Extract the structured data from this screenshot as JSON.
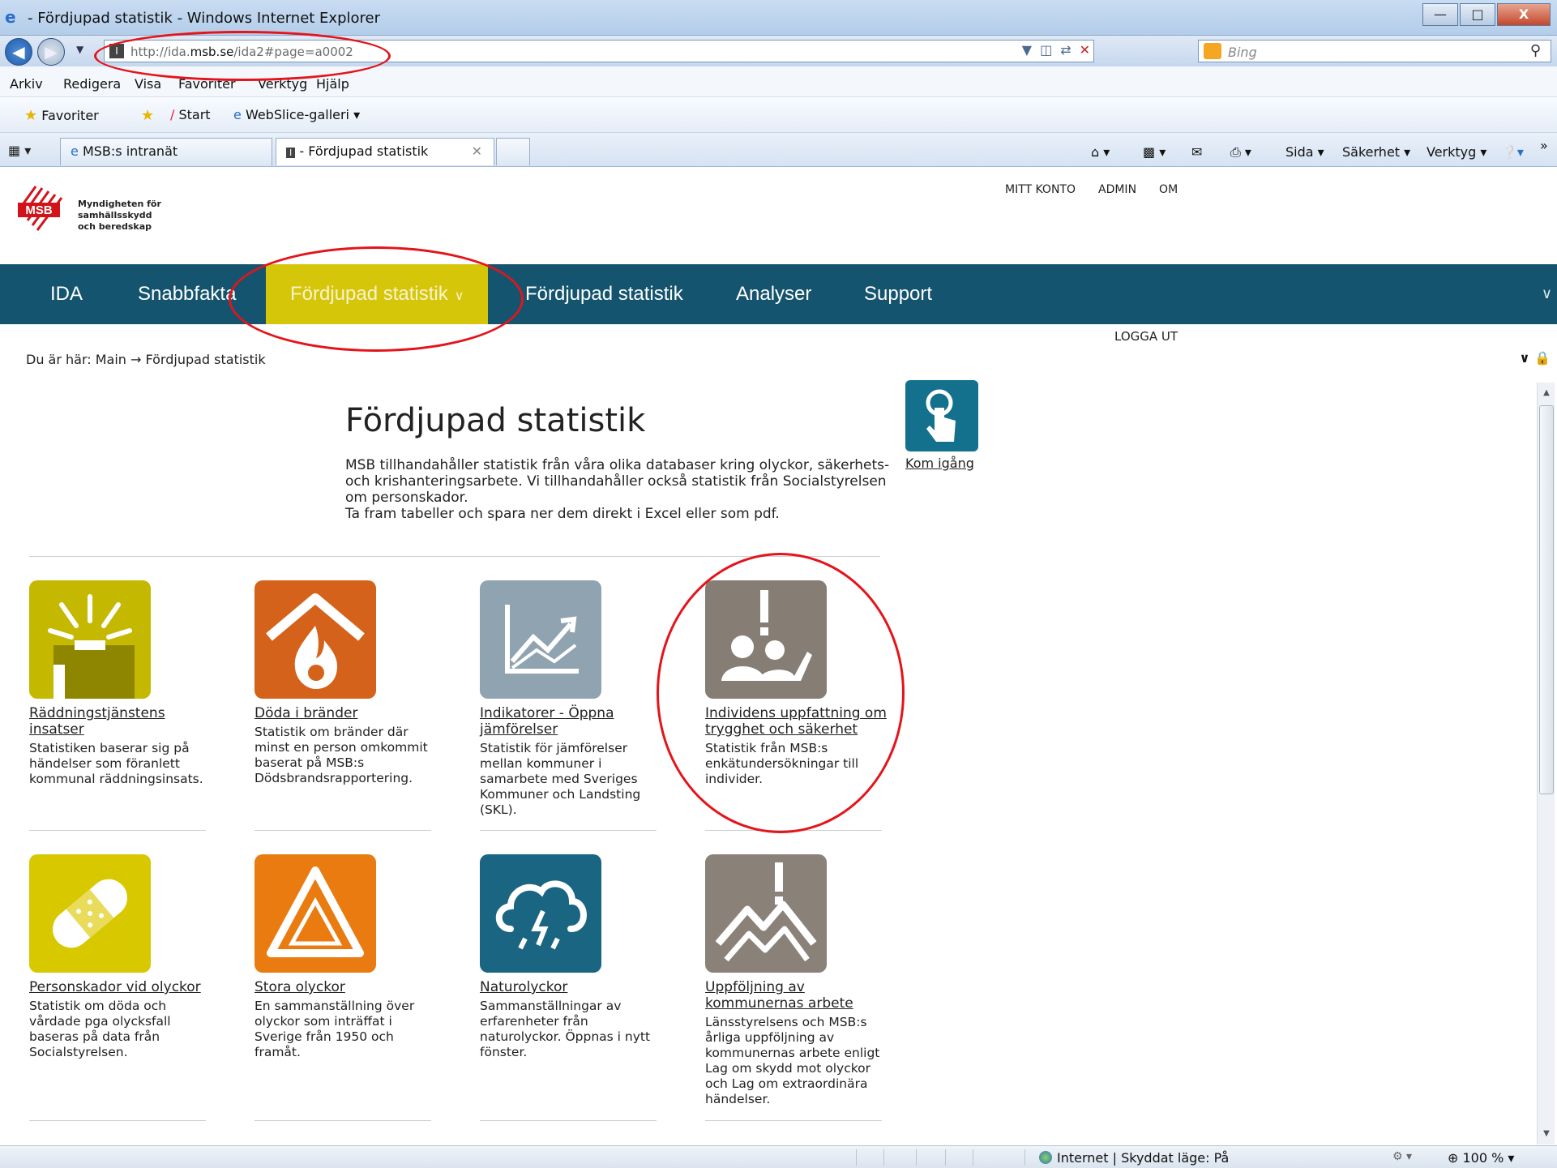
{
  "window": {
    "title": "- Fördjupad statistik - Windows Internet Explorer",
    "min_icon": "minimize-icon",
    "max_icon": "maximize-icon",
    "close_label": "X"
  },
  "address_bar": {
    "url_prefix": "http://ida.",
    "url_domain": "msb.se",
    "url_suffix": "/ida2#page=a0002",
    "search_placeholder": "Bing"
  },
  "menu": [
    "Arkiv",
    "Redigera",
    "Visa",
    "Favoriter",
    "Verktyg",
    "Hjälp"
  ],
  "favorites_bar": {
    "favorites": "Favoriter",
    "start": "Start",
    "webslice": "WebSlice-galleri ▾"
  },
  "tabs": [
    {
      "label": "MSB:s intranät"
    },
    {
      "label": "- Fördjupad statistik"
    }
  ],
  "command_bar": {
    "sida": "Sida ▾",
    "sakerhet": "Säkerhet ▾",
    "verktyg": "Verktyg ▾",
    "more": "»"
  },
  "site": {
    "logo_text_1": "Myndigheten för",
    "logo_text_2": "samhällsskydd",
    "logo_text_3": "och beredskap",
    "logo_abbr": "MSB",
    "top_links": [
      "MITT KONTO",
      "ADMIN",
      "OM"
    ],
    "logout": "LOGGA UT",
    "breadcrumb": "Du är här:  Main → Fördjupad statistik"
  },
  "main_nav": [
    {
      "label": "IDA"
    },
    {
      "label": "Snabbfakta"
    },
    {
      "label": "Fördjupad statistik"
    },
    {
      "label": "Fördjupad statistik"
    },
    {
      "label": "Analyser"
    },
    {
      "label": "Support"
    }
  ],
  "content": {
    "title": "Fördjupad statistik",
    "intro_1": "MSB tillhandahåller statistik från våra olika databaser kring olyckor, säkerhets- och krishanteringsarbete. Vi tillhandahåller också statistik från Socialstyrelsen om personskador.",
    "intro_2": "Ta fram tabeller och spara ner dem direkt i Excel eller som pdf.",
    "kom_igang": "Kom igång"
  },
  "cards": [
    {
      "title": "Räddningstjänstens insatser",
      "desc": "Statistiken baserar sig på händelser som föranlett kommunal räddningsinsats.",
      "icon": "rescue-icon",
      "color": "#c4b800"
    },
    {
      "title": "Döda i bränder",
      "desc": "Statistik om bränder där minst en person omkommit baserat på MSB:s Dödsbrandsrapportering.",
      "icon": "house-fire-icon",
      "color": "#d5621a"
    },
    {
      "title": "Indikatorer - Öppna jämförelser",
      "desc": "Statistik för jämförelser mellan kommuner i samarbete med Sveriges Kommuner och Landsting (SKL).",
      "icon": "line-chart-icon",
      "color": "#8fa3b0"
    },
    {
      "title": "Individens uppfattning om trygghet och säkerhet",
      "desc": "Statistik från MSB:s enkätundersökningar till individer.",
      "icon": "people-alert-icon",
      "color": "#867d74"
    },
    {
      "title": "Personskador vid olyckor",
      "desc": "Statistik om döda och vårdade pga olycksfall baseras på data från Socialstyrelsen.",
      "icon": "bandage-icon",
      "color": "#d8c800"
    },
    {
      "title": "Stora olyckor",
      "desc": "En sammanställning över olyckor som inträffat i Sverige från 1950 och framåt.",
      "icon": "warning-triangle-icon",
      "color": "#e97b10"
    },
    {
      "title": "Naturolyckor",
      "desc": "Sammanställningar av erfarenheter från naturolyckor. Öppnas i nytt fönster.",
      "icon": "storm-cloud-icon",
      "color": "#1a6581"
    },
    {
      "title": "Uppföljning av kommunernas arbete",
      "desc": "Länsstyrelsens och MSB:s årliga uppföljning av kommunernas arbete enligt Lag om skydd mot olyckor och Lag om extraordinära händelser.",
      "icon": "mountain-alert-icon",
      "color": "#8a8178"
    }
  ],
  "status": {
    "zone": "Internet | Skyddat läge: På",
    "zoom": "100 %"
  }
}
